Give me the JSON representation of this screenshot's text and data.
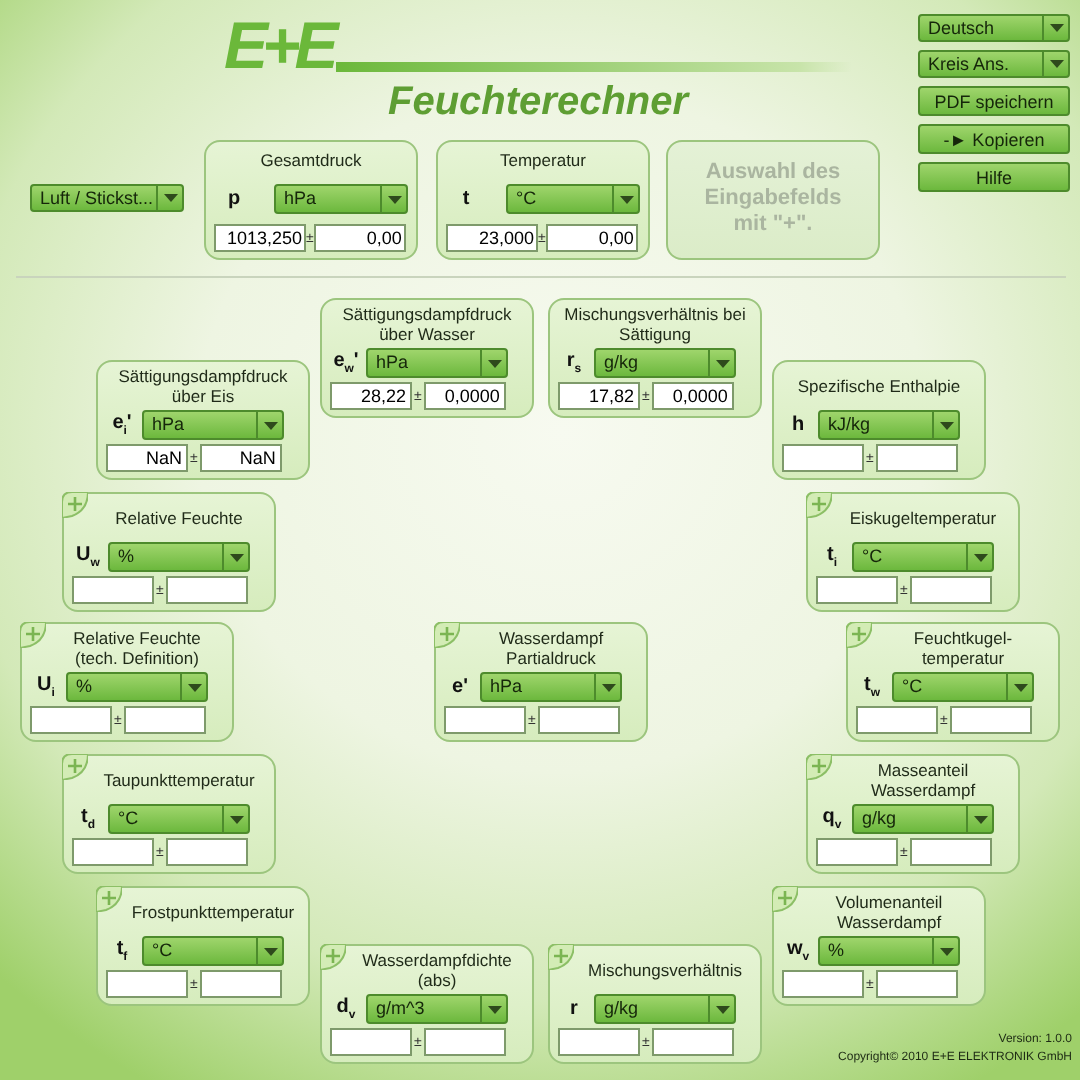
{
  "header": {
    "logo": "E+E",
    "title": "Feuchterechner"
  },
  "medium": {
    "value": "Luft / Stickst..."
  },
  "side_buttons": [
    {
      "kind": "dropdown",
      "label": "Deutsch"
    },
    {
      "kind": "dropdown",
      "label": "Kreis Ans."
    },
    {
      "kind": "button",
      "label": "PDF speichern"
    },
    {
      "kind": "button",
      "label": "-► Kopieren"
    },
    {
      "kind": "button",
      "label": "Hilfe"
    }
  ],
  "inputs": [
    {
      "title": "Gesamtdruck",
      "symbol": "p",
      "unit": "hPa",
      "value": "1013,250",
      "sep": "±",
      "tolerance": "0,00"
    },
    {
      "title": "Temperatur",
      "symbol": "t",
      "unit": "°C",
      "value": "23,000",
      "sep": "±",
      "tolerance": "0,00"
    }
  ],
  "hint": {
    "text": "Auswahl des Eingabefelds mit \"+\".",
    "disabled": true
  },
  "results": [
    {
      "title": "Sättigungsdampfdruck über Eis",
      "symbol": "e$_{i}$'",
      "unit": "hPa",
      "value": "NaN",
      "sep": "±",
      "tolerance": "NaN",
      "addable": false
    },
    {
      "title": "Sättigungsdampfdruck über Wasser",
      "symbol": "e$_{w}$'",
      "unit": "hPa",
      "value": "28,22",
      "sep": "±",
      "tolerance": "0,0000",
      "addable": false
    },
    {
      "title": "Mischungsverhältnis bei Sättigung",
      "symbol": "r$_{s}$",
      "unit": "g/kg",
      "value": "17,82",
      "sep": "±",
      "tolerance": "0,0000",
      "addable": false
    },
    {
      "title": "Spezifische Enthalpie",
      "symbol": "h",
      "unit": "kJ/kg",
      "sep": "±",
      "addable": false
    },
    {
      "title": "Relative Feuchte",
      "symbol": "U$_{w}$",
      "unit": "%",
      "sep": "±",
      "addable": true
    },
    {
      "title": "Eiskugeltemperatur",
      "symbol": "t$_{i}$",
      "unit": "°C",
      "sep": "±",
      "addable": true
    },
    {
      "title": "Relative Feuchte (tech. Definition)",
      "symbol": "U$_{i}$",
      "unit": "%",
      "sep": "±",
      "addable": true
    },
    {
      "title": "Wasserdampf Partialdruck",
      "symbol": "e'",
      "unit": "hPa",
      "sep": "±",
      "addable": true
    },
    {
      "title": "Feuchtkugel-temperatur",
      "symbol": "t$_{w}$",
      "unit": "°C",
      "sep": "±",
      "addable": true
    },
    {
      "title": "Taupunkttemperatur",
      "symbol": "t$_{d}$",
      "unit": "°C",
      "sep": "±",
      "addable": true
    },
    {
      "title": "Masseanteil Wasserdampf",
      "symbol": "q$_{v}$",
      "unit": "g/kg",
      "sep": "±",
      "addable": true
    },
    {
      "title": "Frostpunkttemperatur",
      "symbol": "t$_{f}$",
      "unit": "°C",
      "sep": "±",
      "addable": true
    },
    {
      "title": "Wasserdampfdichte (abs)",
      "symbol": "d$_{v}$",
      "unit": "g/m^3",
      "sep": "±",
      "addable": true
    },
    {
      "title": "Mischungsverhältnis",
      "symbol": "r",
      "unit": "g/kg",
      "sep": "±",
      "addable": true
    },
    {
      "title": "Volumenanteil Wasserdampf",
      "symbol": "w$_{v}$",
      "unit": "%",
      "sep": "±",
      "addable": true
    }
  ],
  "footer": {
    "version": "Version: 1.0.0",
    "copyright": "Copyright© 2010 E+E ELEKTRONIK GmbH"
  }
}
